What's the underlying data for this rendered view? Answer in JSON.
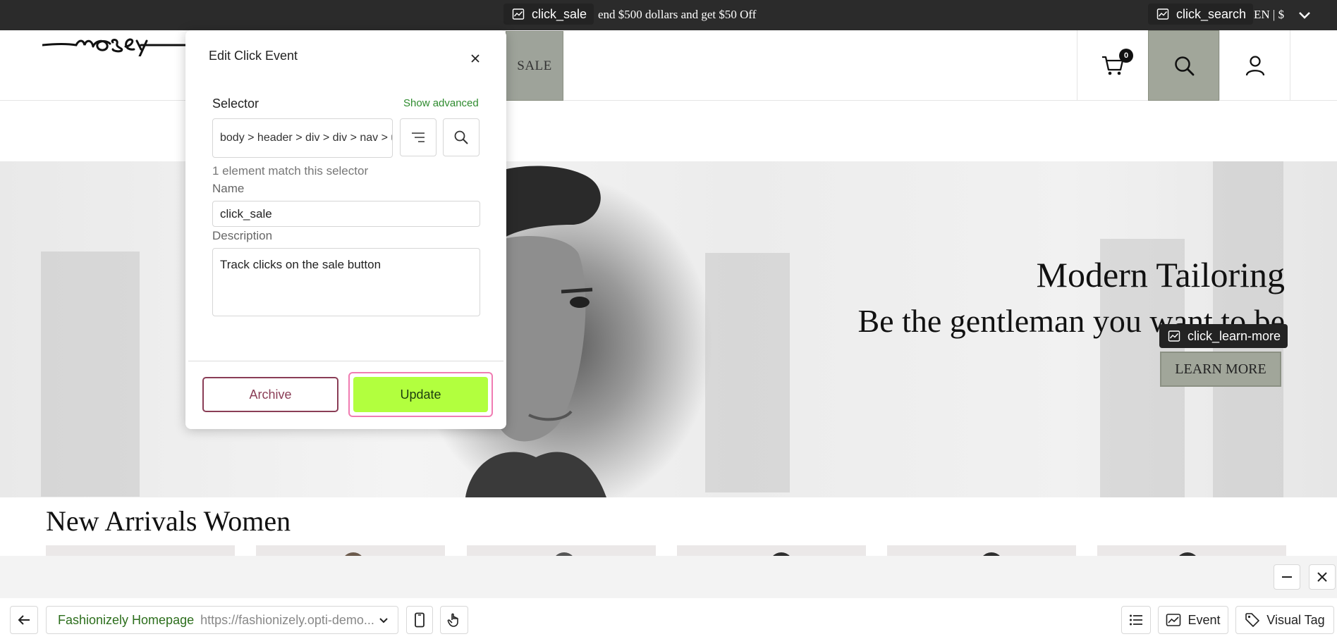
{
  "announcement": {
    "promo": "end $500 dollars and get $50 Off",
    "locale": "EN | $"
  },
  "tags": {
    "sale": "click_sale",
    "search": "click_search",
    "learn_more": "click_learn-more"
  },
  "header": {
    "logo_text": "mosey",
    "sale_label": "SALE",
    "cart_count": "0"
  },
  "hero": {
    "title": "Modern Tailoring",
    "subtitle": "Be the gentleman you want to be",
    "cta": "LEARN MORE"
  },
  "arrivals": {
    "title": "New Arrivals Women"
  },
  "modal": {
    "title": "Edit Click Event",
    "selector_label": "Selector",
    "show_advanced": "Show advanced",
    "selector_value": "body > header > div > div > nav > ul > li > a",
    "match_text": "1 element match this selector",
    "name_label": "Name",
    "name_value": "click_sale",
    "description_label": "Description",
    "description_value": "Track clicks on the sale button",
    "archive_label": "Archive",
    "update_label": "Update"
  },
  "toolbar": {
    "page_name": "Fashionizely Homepage",
    "page_url": "https://fashionizely.opti-demo...",
    "event_label": "Event",
    "visual_tag_label": "Visual Tag"
  },
  "colors": {
    "accent_green": "#b2ff3e",
    "archive_maroon": "#8a3d56",
    "highlight_sage": "#a1a69a",
    "focus_pink": "#f07cb2"
  },
  "icons": [
    "event-tag-icon",
    "chevron-down-icon",
    "cart-icon",
    "search-icon",
    "user-icon",
    "close-icon",
    "filter-icon",
    "minimize-icon",
    "arrow-left-icon",
    "mobile-device-icon",
    "pointer-hand-icon",
    "list-icon",
    "price-tag-icon"
  ]
}
